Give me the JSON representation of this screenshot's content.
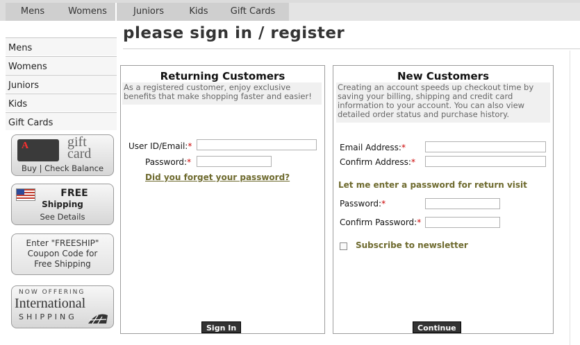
{
  "topnav": {
    "tabs": [
      {
        "label": "Mens"
      },
      {
        "label": "Womens"
      },
      {
        "label": "Juniors"
      },
      {
        "label": "Kids"
      },
      {
        "label": "Gift Cards"
      }
    ]
  },
  "sidebar": {
    "items": [
      {
        "label": "Mens"
      },
      {
        "label": "Womens"
      },
      {
        "label": "Juniors"
      },
      {
        "label": "Kids"
      },
      {
        "label": "Gift Cards"
      }
    ],
    "promos": {
      "giftcard": {
        "logo": "gift card",
        "brand": "A",
        "caption": "Buy | Check Balance"
      },
      "shipping": {
        "title": "FREE",
        "subtitle": "Shipping",
        "link": "See Details"
      },
      "coupon": {
        "line1": "Enter \"FREESHIP\"",
        "line2": "Coupon Code for",
        "line3": "Free Shipping"
      },
      "international": {
        "line1": "NOW OFFERING",
        "line2": "International",
        "line3": "SHIPPING"
      }
    }
  },
  "page": {
    "title": "please sign in / register"
  },
  "returning": {
    "heading": "Returning Customers",
    "description": "As a registered customer, enjoy exclusive benefits that make shopping faster and easier!",
    "userid_label": "User ID/Email:",
    "password_label": "Password:",
    "userid_value": "",
    "password_value": "",
    "forgot_link": "Did you forget your password?",
    "signin_button": "Sign In"
  },
  "newcust": {
    "heading": "New Customers",
    "description": "Creating an account speeds up checkout time by saving your billing, shipping and credit card information to your account. You can also view detailed order status and purchase history.",
    "email_label": "Email Address:",
    "confirm_email_label": "Confirm Address:",
    "password_prompt": "Let me enter a password for return visit",
    "password_label": "Password:",
    "confirm_password_label": "Confirm Password:",
    "subscribe_label": "Subscribe to newsletter",
    "continue_button": "Continue"
  },
  "required_mark": "*",
  "colors": {
    "accent": "#6e6a2e",
    "required": "#cc0000",
    "button": "#333333"
  }
}
